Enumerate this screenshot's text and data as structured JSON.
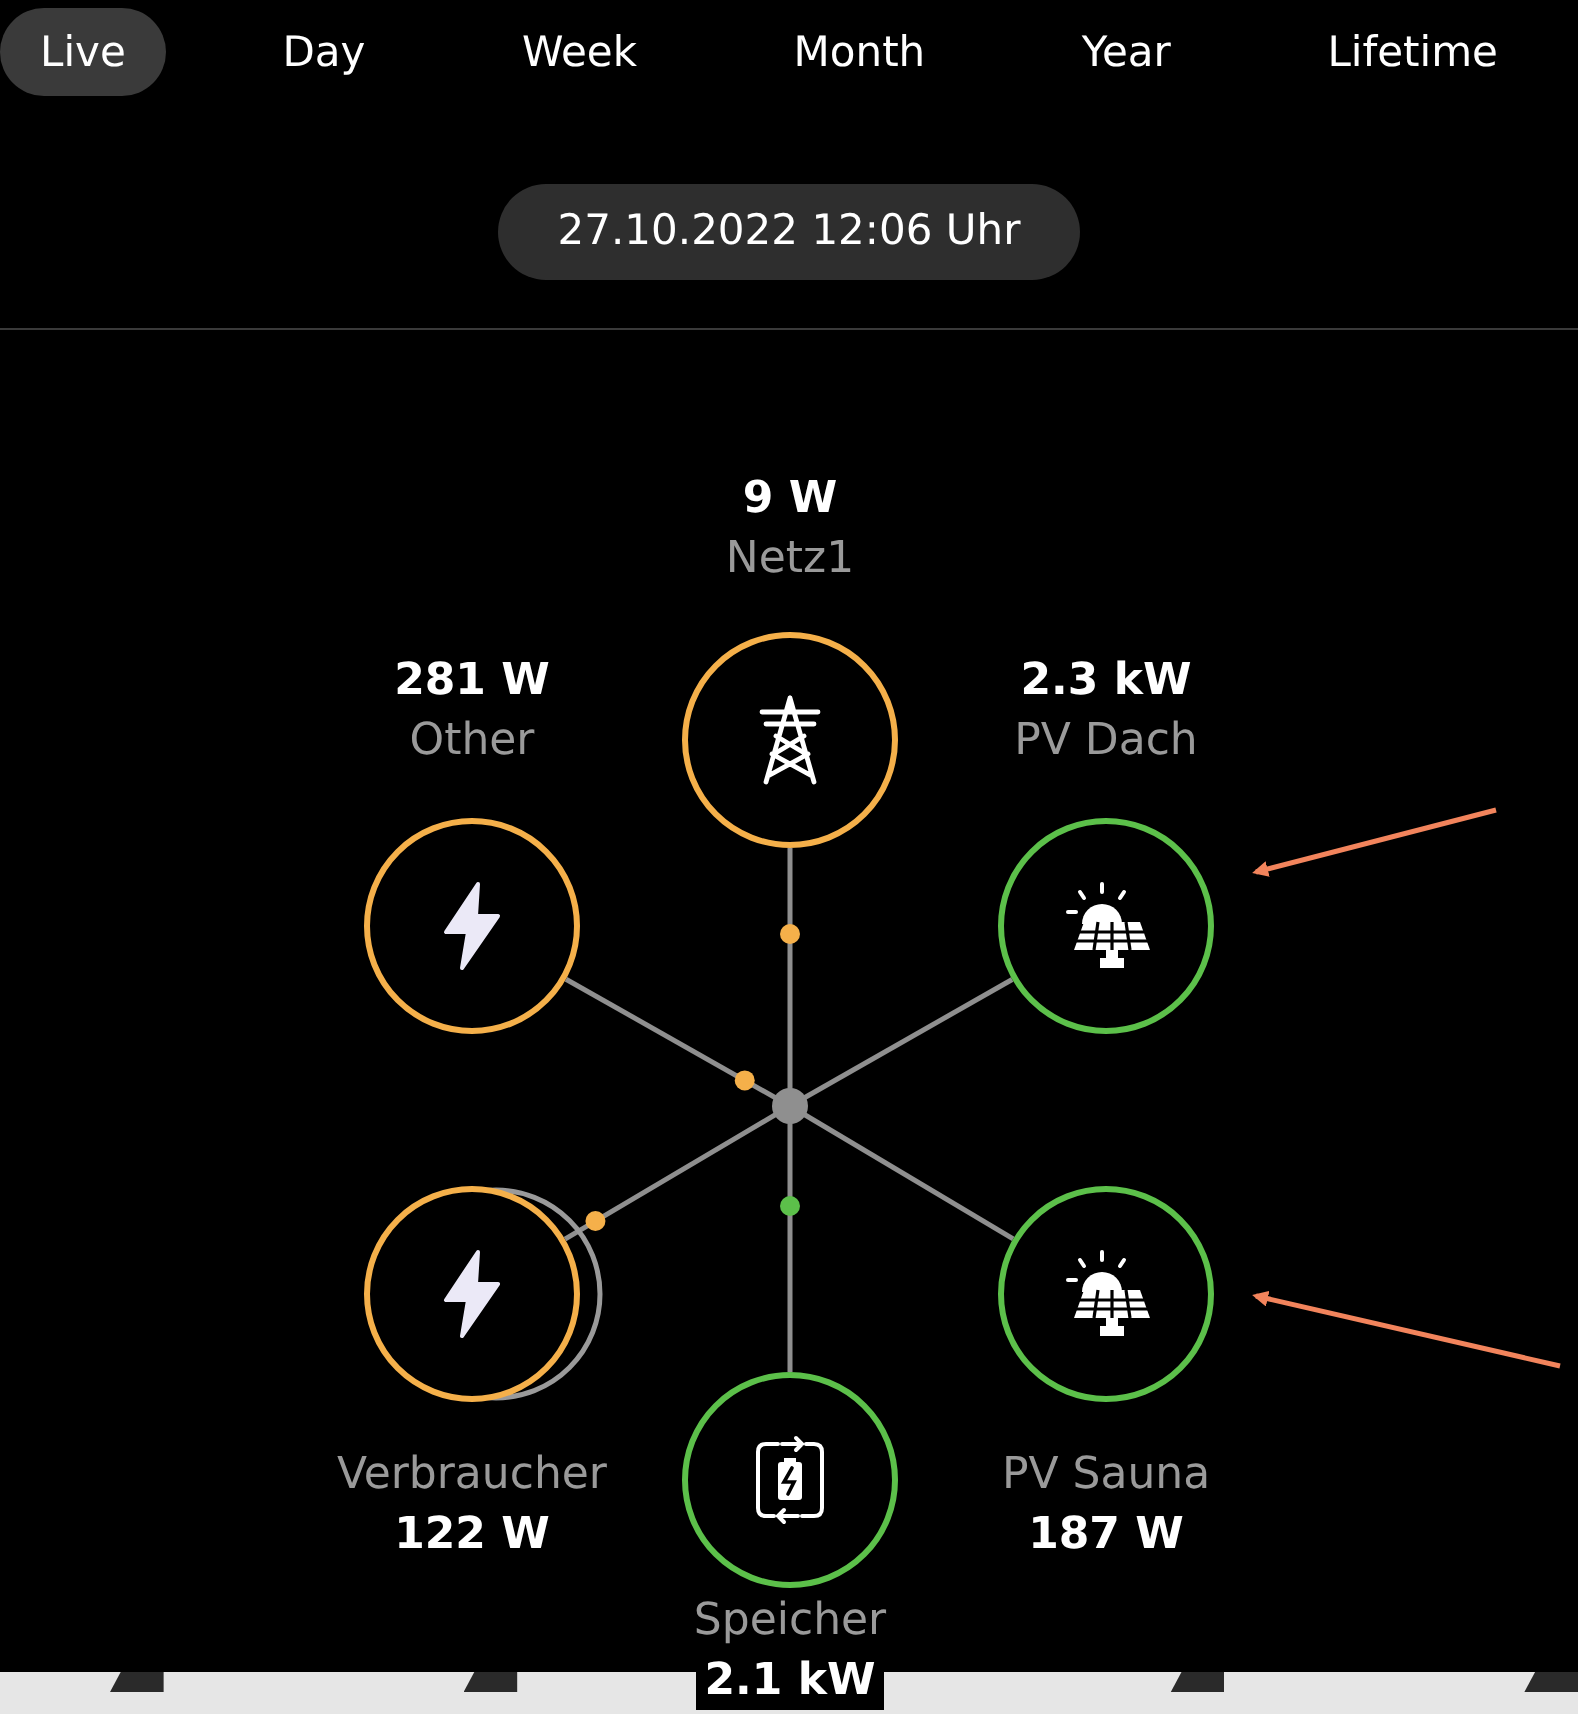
{
  "tabs": [
    {
      "label": "Live",
      "selected": true
    },
    {
      "label": "Day",
      "selected": false
    },
    {
      "label": "Week",
      "selected": false
    },
    {
      "label": "Month",
      "selected": false
    },
    {
      "label": "Year",
      "selected": false
    },
    {
      "label": "Lifetime",
      "selected": false
    }
  ],
  "timestamp": "27.10.2022 12:06 Uhr",
  "nodes": [
    {
      "kind": "grid",
      "name": "Netz1",
      "value": "9  W",
      "color": "#f5b04a",
      "flow_dot": true,
      "ghost": false
    },
    {
      "kind": "consumer",
      "name": "Other",
      "value": "281  W",
      "color": "#f5b04a",
      "flow_dot": true,
      "ghost": false
    },
    {
      "kind": "solar",
      "name": "PV Dach",
      "value": "2.3  kW",
      "color": "#5cc04a",
      "flow_dot": false,
      "ghost": false
    },
    {
      "kind": "consumer",
      "name": "Verbraucher",
      "value": "122  W",
      "color": "#f5b04a",
      "flow_dot": true,
      "ghost": true
    },
    {
      "kind": "solar",
      "name": "PV Sauna",
      "value": "187  W",
      "color": "#5cc04a",
      "flow_dot": false,
      "ghost": false
    },
    {
      "kind": "battery",
      "name": "Speicher",
      "value": "2.1  kW",
      "color": "#5cc04a",
      "flow_dot": true,
      "ghost": false
    }
  ]
}
